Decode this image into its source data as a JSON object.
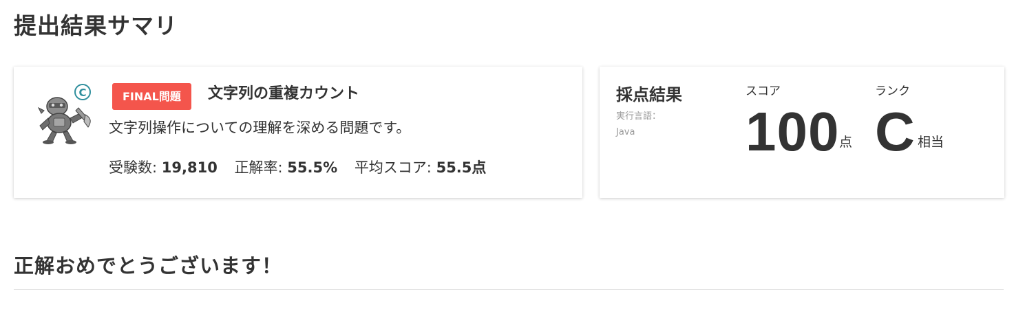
{
  "page": {
    "title": "提出結果サマリ"
  },
  "problem": {
    "avatar_icon": "robot-rank-c-avatar",
    "avatar_rank_letter": "C",
    "badge": "FINAL問題",
    "title": "文字列の重複カウント",
    "description": "文字列操作についての理解を深める問題です。",
    "stats": {
      "examinees_label": "受験数:",
      "examinees_value": "19,810",
      "accuracy_label": "正解率:",
      "accuracy_value": "55.5%",
      "avg_score_label": "平均スコア:",
      "avg_score_value": "55.5点"
    }
  },
  "result": {
    "heading": "採点結果",
    "language_label": "実行言語：",
    "language_value": "Java",
    "score_label": "スコア",
    "score_value": "100",
    "score_unit": "点",
    "rank_label": "ランク",
    "rank_value": "C",
    "rank_unit": "相当"
  },
  "message": {
    "congrats": "正解おめでとうございます！"
  },
  "colors": {
    "badge": "#f4554c",
    "text": "#333333",
    "muted": "#999999",
    "rank_badge": "#2f8f9d"
  }
}
